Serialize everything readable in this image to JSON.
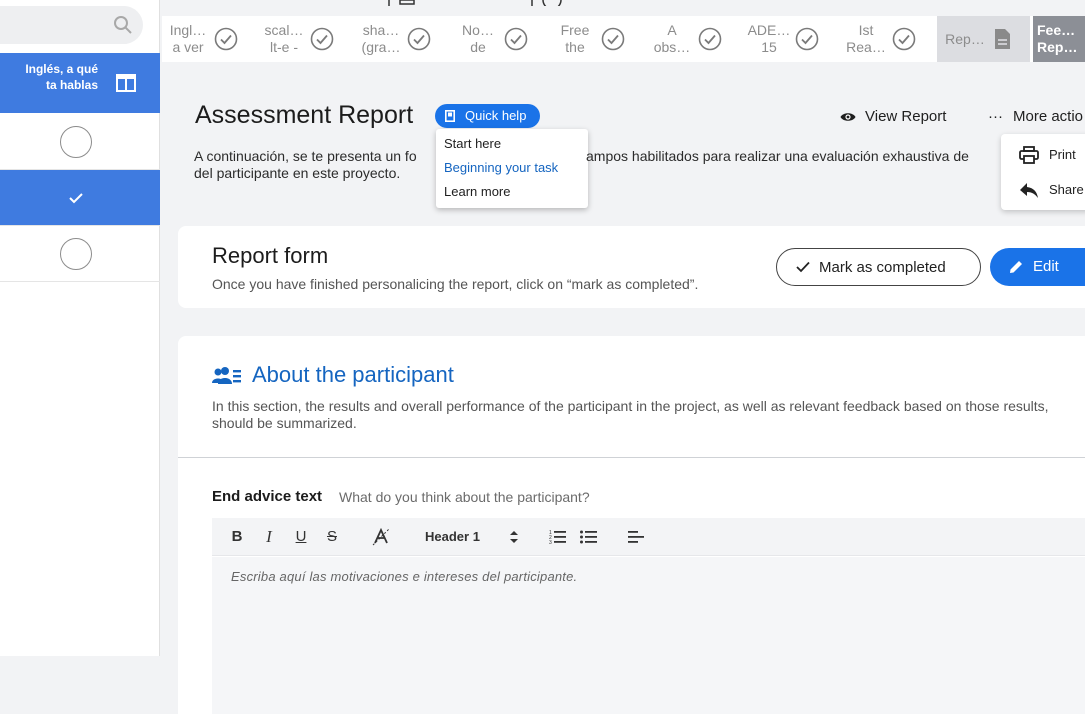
{
  "sidebar": {
    "column_header": "Inglés, a qué ta hablas",
    "rows": [
      {
        "state": "empty"
      },
      {
        "state": "checked"
      },
      {
        "state": "empty"
      }
    ]
  },
  "steps": [
    {
      "label": "Ingl… a ver",
      "state": "done"
    },
    {
      "label": "scal… lt-e -",
      "state": "done"
    },
    {
      "label": "sha… (gra…",
      "state": "done"
    },
    {
      "label": "No… de",
      "state": "done"
    },
    {
      "label": "Free the",
      "state": "done"
    },
    {
      "label": "A obs…",
      "state": "done"
    },
    {
      "label": "ADE… 15",
      "state": "done"
    },
    {
      "label": "Ist Rea…",
      "state": "done"
    },
    {
      "label": "Rep…",
      "state": "active"
    },
    {
      "label": "Fee… Rep…",
      "state": "dark"
    }
  ],
  "header": {
    "title": "Assessment Report",
    "quick_help_label": "Quick help",
    "quick_help_menu": [
      "Start here",
      "Beginning your task",
      "Learn more"
    ],
    "description_part1": "A continuación, se te presenta un fo",
    "description_part2": "ampos habilitados para realizar una evaluación exhaustiva de",
    "description_part3": "del participante en este proyecto.",
    "view_report": "View Report",
    "more_actions": "More actio",
    "more_menu": [
      "Print",
      "Share"
    ]
  },
  "report_form": {
    "title": "Report form",
    "subtitle": "Once you have finished personalicing the report, click on “mark as completed”.",
    "mark_completed": "Mark as completed",
    "edit": "Edit"
  },
  "participant": {
    "title": "About the participant",
    "description": "In this section, the results and overall performance of the participant in the project, as well as relevant feedback based on those results, should be summarized.",
    "field_label": "End advice text",
    "field_hint": "What do you think about the participant?",
    "toolbar": {
      "bold": "B",
      "italic": "I",
      "underline": "U",
      "strike": "S",
      "header": "Header 1"
    },
    "placeholder": "Escriba aquí las motivaciones e intereses del participante."
  },
  "colors": {
    "primary": "#1a73e8",
    "accent": "#3f7be0",
    "heading_blue": "#1565c0"
  }
}
